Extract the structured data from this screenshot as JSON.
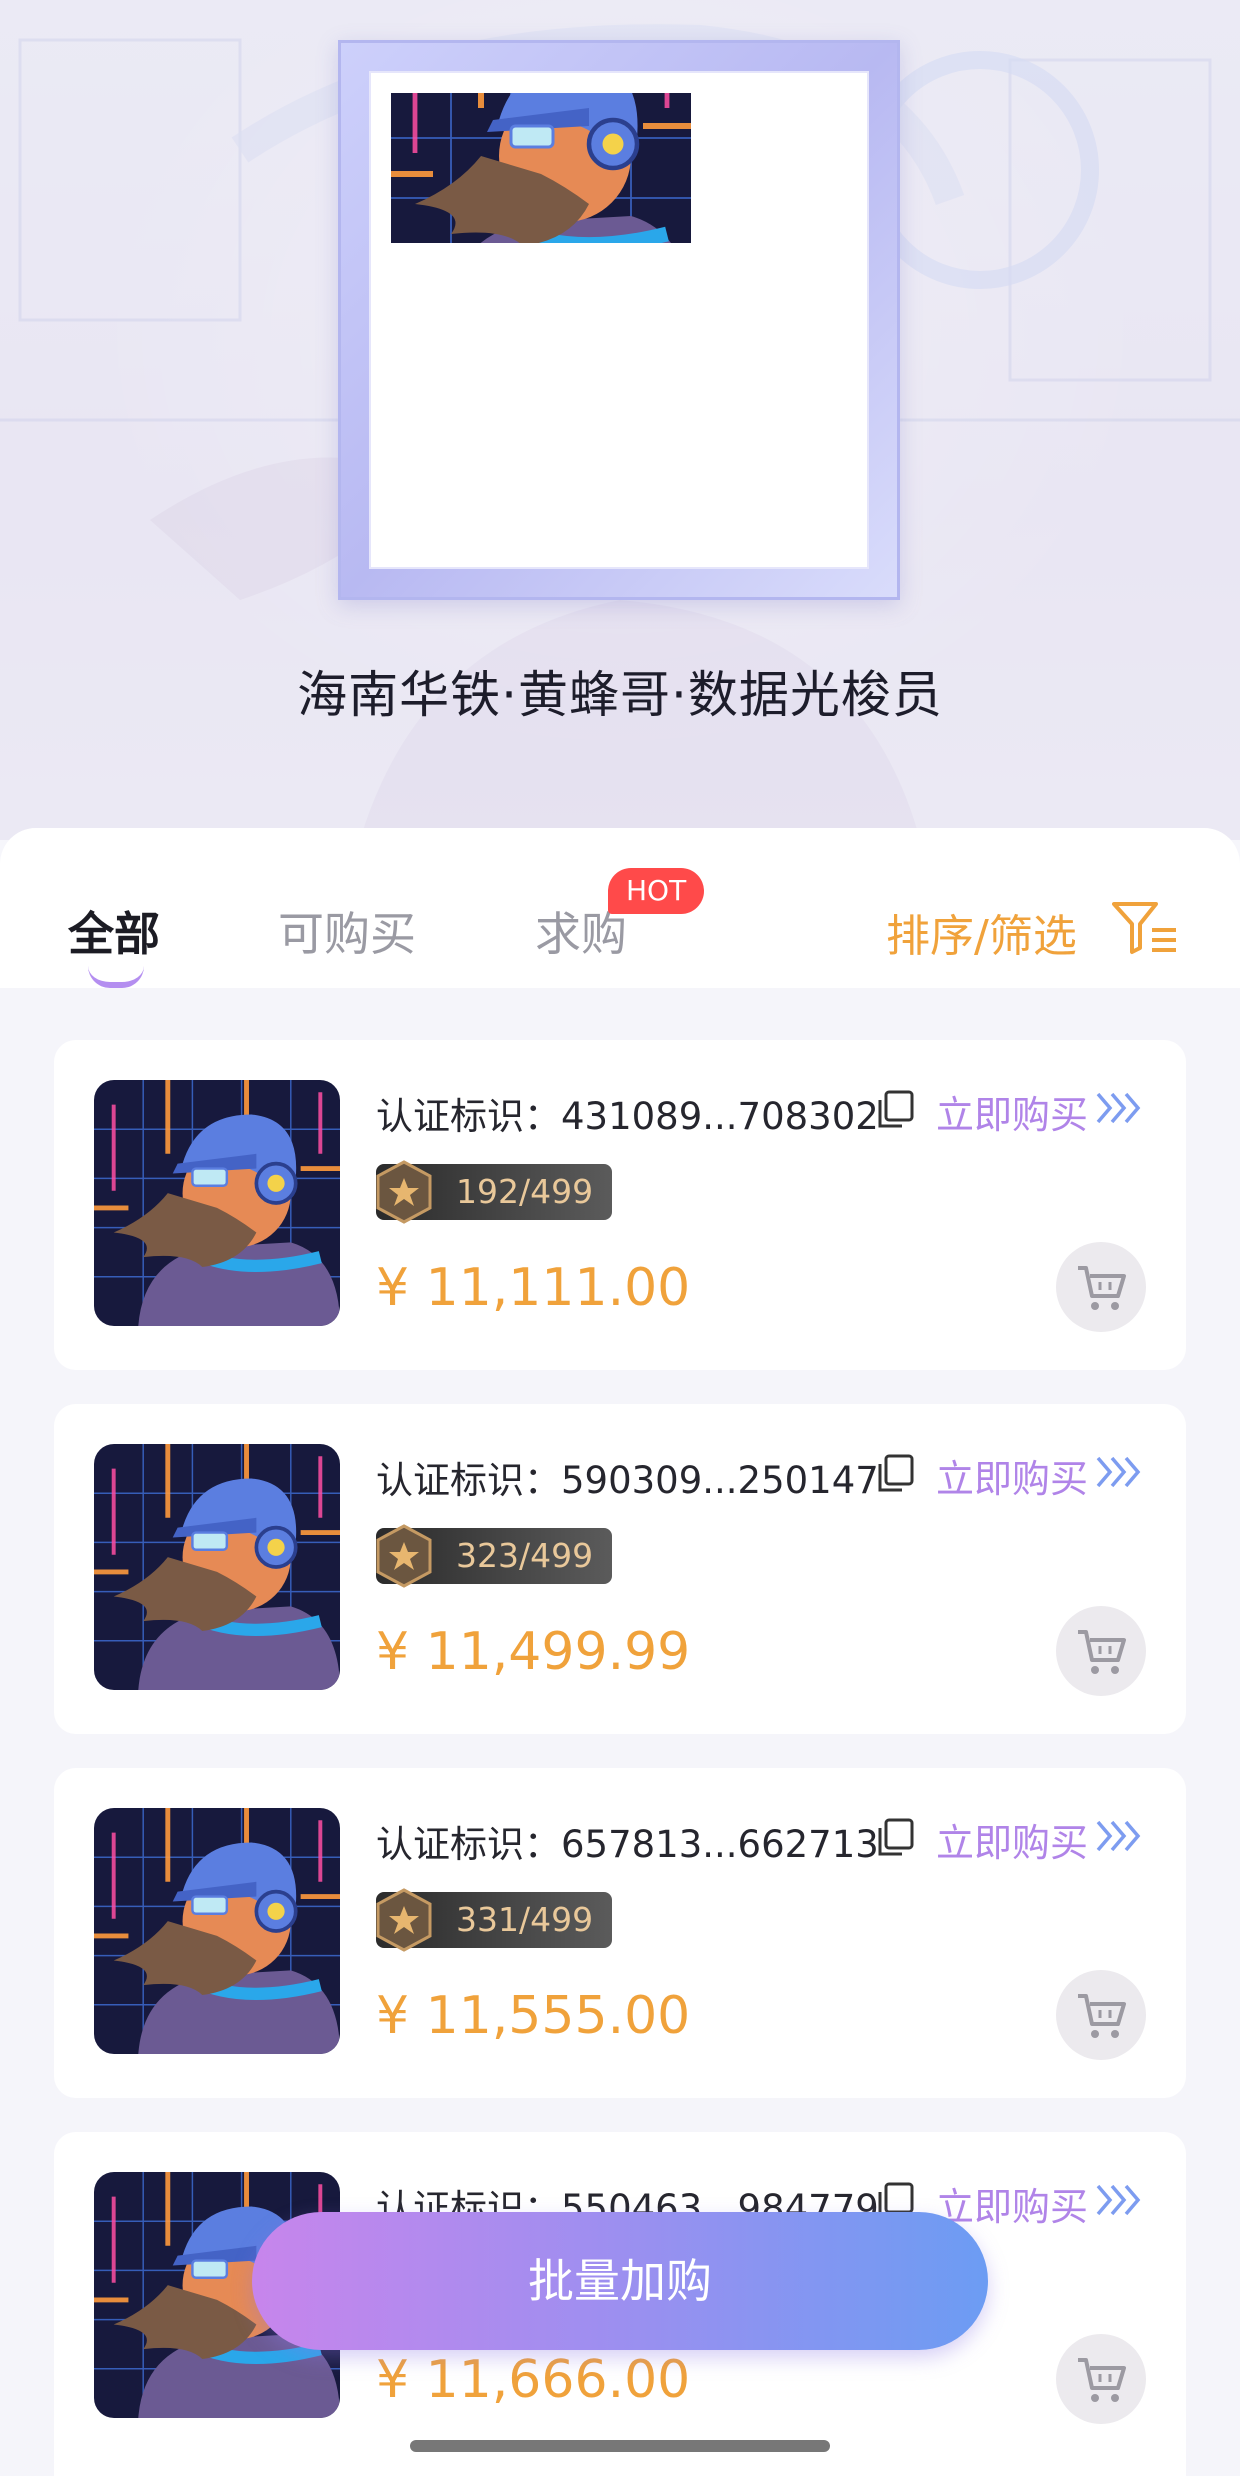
{
  "hero": {
    "title": "海南华铁·黄蜂哥·数据光梭员"
  },
  "tabs": {
    "items": [
      {
        "label": "全部",
        "active": true
      },
      {
        "label": "可购买",
        "active": false
      },
      {
        "label": "求购",
        "active": false
      }
    ],
    "hot_badge": "HOT",
    "sort_label": "排序/筛选"
  },
  "cards": [
    {
      "cert": "认证标识：431089...708302",
      "edition": "192/499",
      "price": "¥ 11,111.00",
      "buy_label": "立即购买"
    },
    {
      "cert": "认证标识：590309...250147",
      "edition": "323/499",
      "price": "¥ 11,499.99",
      "buy_label": "立即购买"
    },
    {
      "cert": "认证标识：657813...662713",
      "edition": "331/499",
      "price": "¥ 11,555.00",
      "buy_label": "立即购买"
    },
    {
      "cert": "认证标识：550463...984779",
      "edition": "",
      "price": "¥ 11,666.00",
      "buy_label": "立即购买"
    }
  ],
  "batch_button": "批量加购",
  "colors": {
    "accent_orange": "#f0a23b",
    "accent_purple": "#b084e8",
    "hot_red": "#ff4a4a"
  }
}
